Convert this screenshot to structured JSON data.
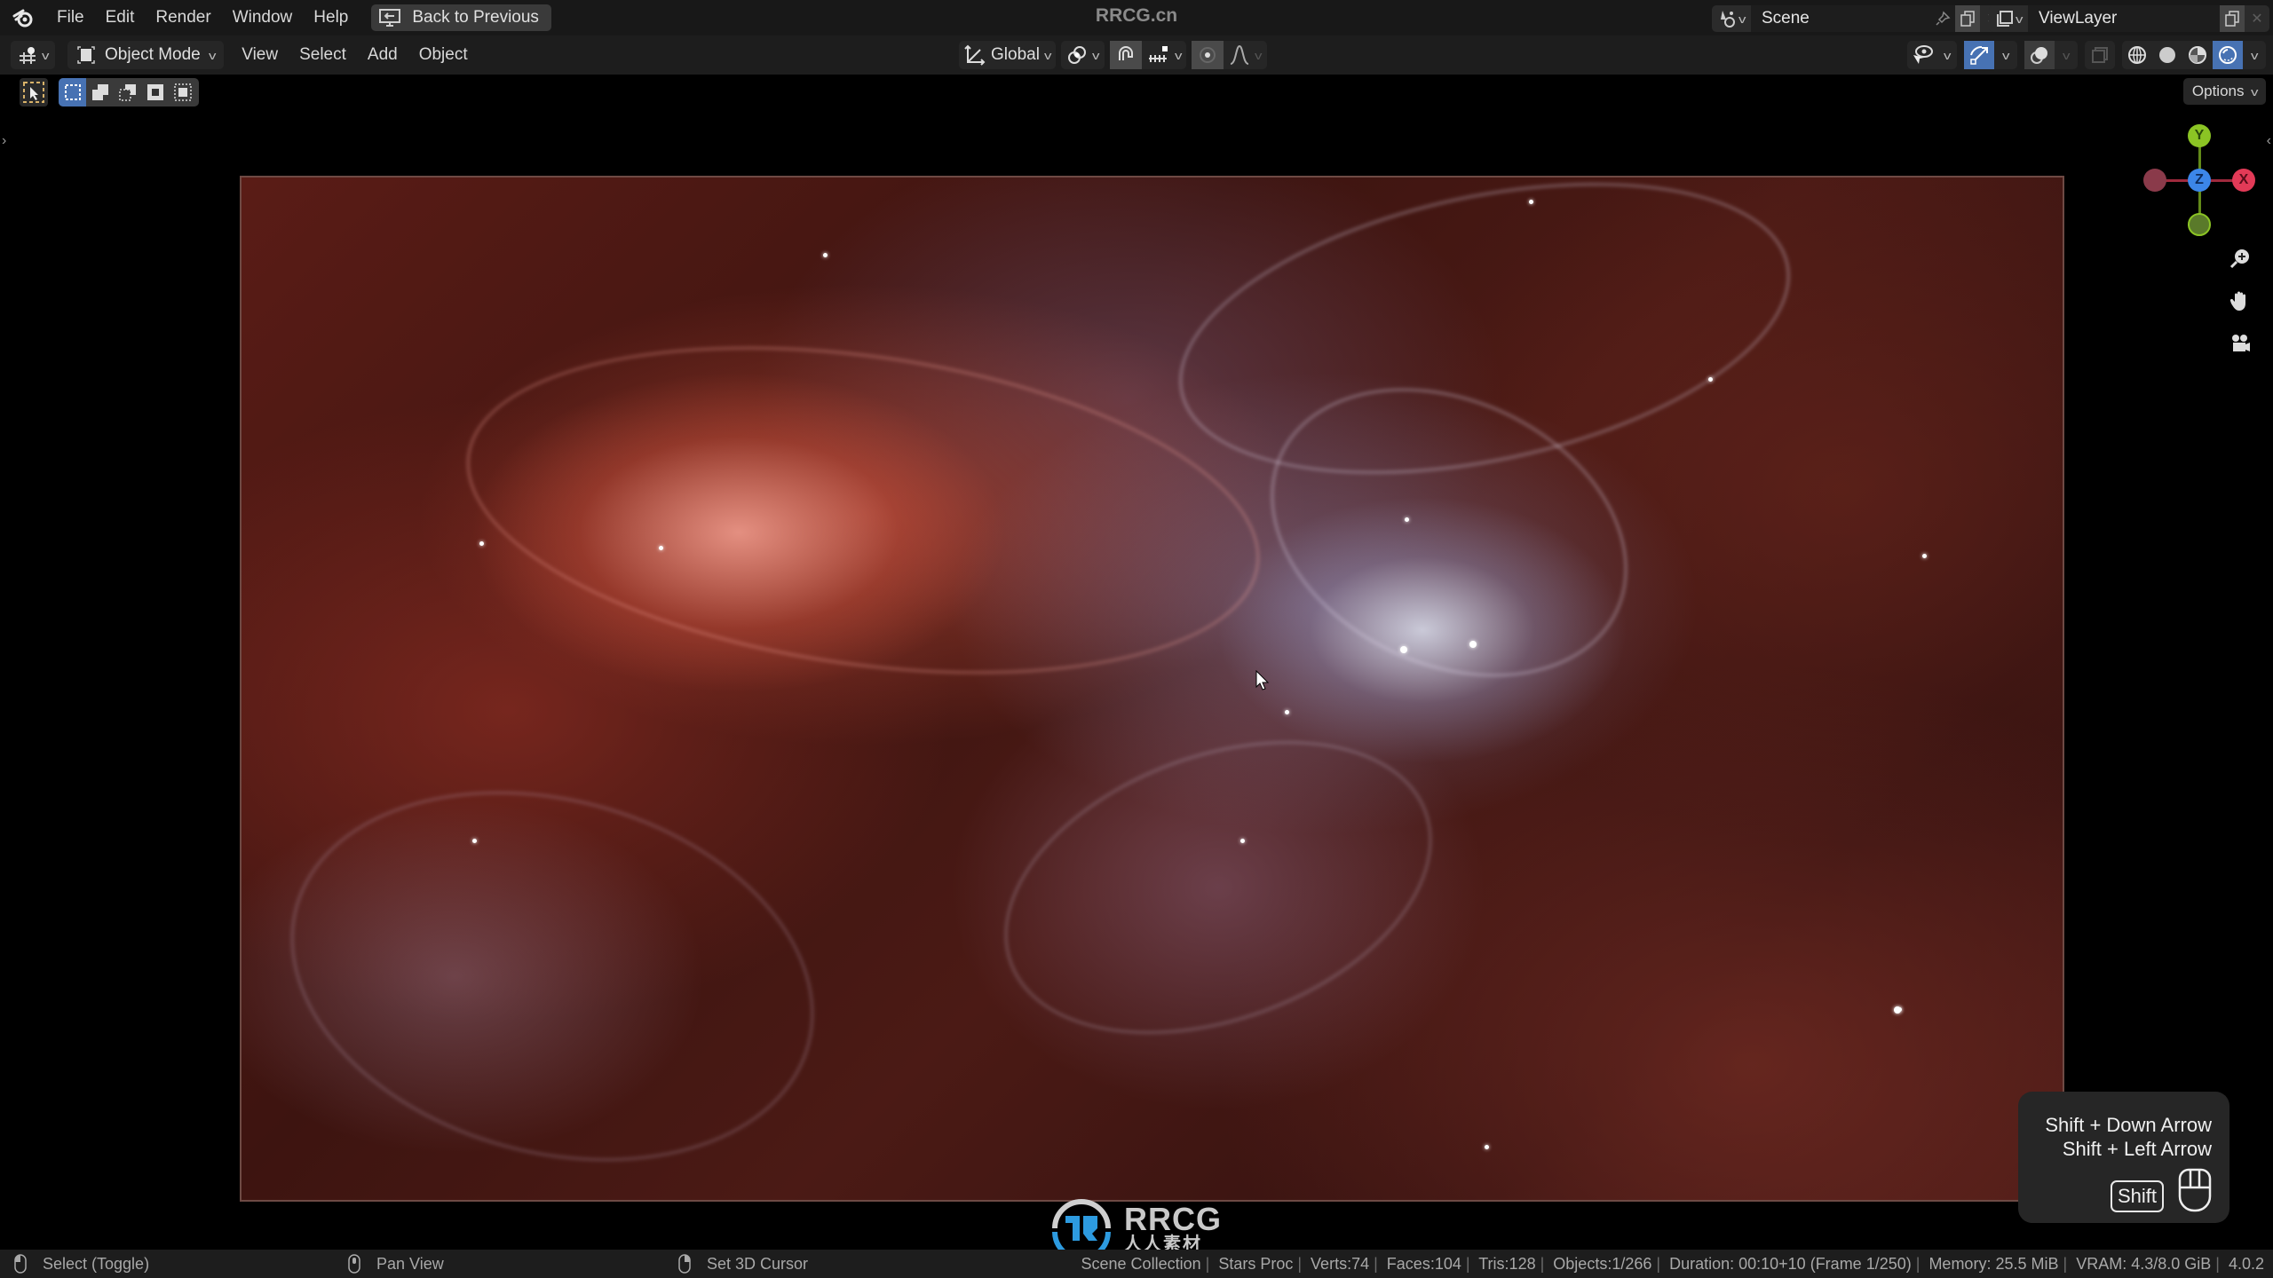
{
  "app": {
    "title": "RRCG.cn"
  },
  "topbar": {
    "menu": [
      "File",
      "Edit",
      "Render",
      "Window",
      "Help"
    ],
    "back_button": "Back to Previous",
    "scene": {
      "name": "Scene",
      "icons": [
        "scene-selector-icon",
        "pin-icon",
        "duplicate-icon",
        "close-icon"
      ]
    },
    "view_layer": {
      "name": "ViewLayer",
      "icons": [
        "viewlayer-selector-icon",
        "duplicate-icon",
        "close-icon"
      ]
    }
  },
  "header": {
    "editor_type_icon": "3d-viewport-icon",
    "mode": "Object Mode",
    "menu": [
      "View",
      "Select",
      "Add",
      "Object"
    ],
    "transform_orientation": "Global",
    "pivot_icon": "pivot-point-icon",
    "snap_icon": "snap-magnet-icon",
    "snap_target_icon": "snap-increment-icon",
    "proportional_icon": "proportional-edit-icon",
    "falloff_icon": "falloff-curve-icon",
    "right_icons": [
      "visibility-selectability-icon",
      "gizmo-toggle-icon",
      "overlays-icon",
      "xray-icon",
      "wireframe-shading-icon",
      "solid-shading-icon",
      "material-preview-icon",
      "rendered-shading-icon"
    ],
    "active_shading": "rendered"
  },
  "tool_row": {
    "select_tool_icon": "select-box-icon",
    "selection_modes": [
      "set-new-selection",
      "extend-selection",
      "subtract-selection",
      "invert-selection",
      "intersect-selection"
    ],
    "active_selection_mode": 0,
    "options_label": "Options"
  },
  "gizmo": {
    "axes": [
      {
        "label": "Y",
        "color": "#8bc424"
      },
      {
        "label": "Z",
        "color": "#3c86e8"
      },
      {
        "label": "X",
        "color": "#e23a57"
      }
    ],
    "nav_buttons": [
      "zoom-icon",
      "pan-hand-icon",
      "camera-view-icon"
    ]
  },
  "key_overlay": {
    "lines": [
      "Shift + Down Arrow",
      "Shift + Left Arrow"
    ],
    "key": "Shift",
    "mouse_icon": "mouse-icon"
  },
  "watermark": {
    "logo_main": "RRCG",
    "logo_sub": "人人素材",
    "brand_color": "#2d9be0"
  },
  "statusbar": {
    "hints": [
      {
        "icon": "mouse-left-icon",
        "label": "Select (Toggle)"
      },
      {
        "icon": "mouse-middle-icon",
        "label": "Pan View"
      },
      {
        "icon": "mouse-right-icon",
        "label": "Set 3D Cursor"
      }
    ],
    "info": [
      "Scene Collection",
      "Stars Proc",
      "Verts:74",
      "Faces:104",
      "Tris:128",
      "Objects:1/266",
      "Duration: 00:10+10 (Frame 1/250)",
      "Memory: 25.5 MiB",
      "VRAM: 4.3/8.0 GiB",
      "4.0.2"
    ]
  },
  "colors": {
    "accent_blue": "#4772b3",
    "topbar_bg": "#181818",
    "header_bg": "#1d1d1d",
    "nebula_red": "#5a1c16",
    "nebula_highlight": "#dce1f0"
  }
}
